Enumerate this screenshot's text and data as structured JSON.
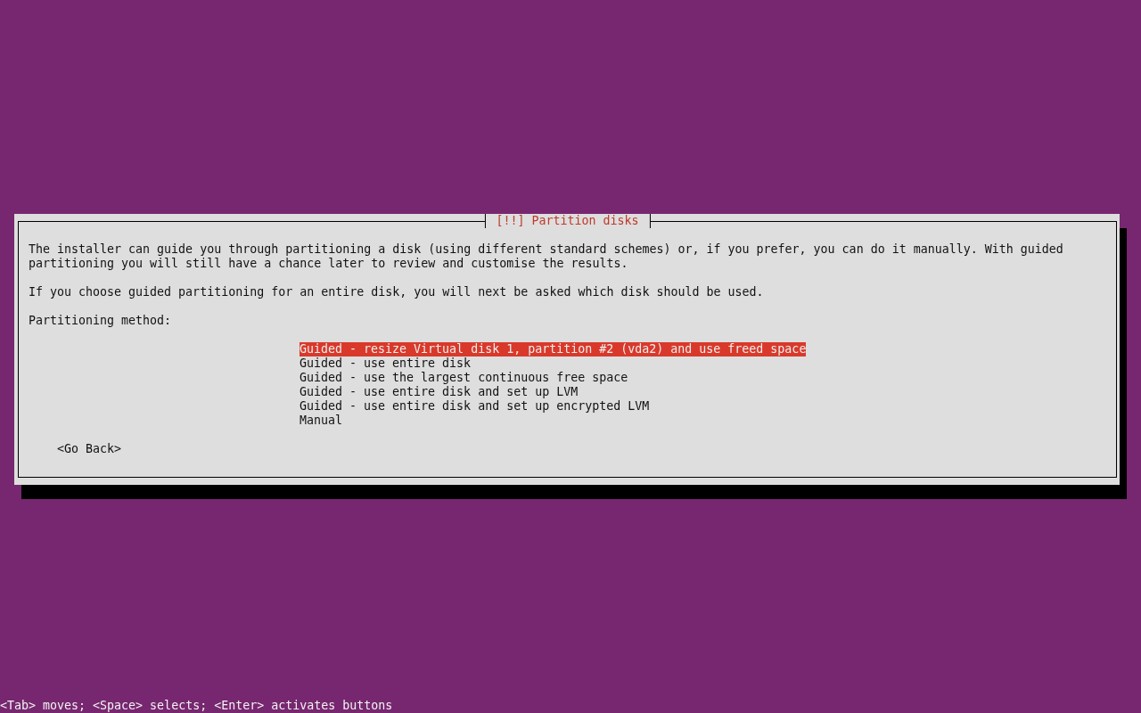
{
  "dialog": {
    "title": "[!!] Partition disks",
    "paragraphs": [
      "The installer can guide you through partitioning a disk (using different standard schemes) or, if you prefer, you can do it manually. With guided partitioning you will still have a chance later to review and customise the results.",
      "If you choose guided partitioning for an entire disk, you will next be asked which disk should be used."
    ],
    "prompt": "Partitioning method:",
    "options": [
      {
        "label": "Guided - resize Virtual disk 1, partition #2 (vda2) and use freed space",
        "selected": true
      },
      {
        "label": "Guided - use entire disk",
        "selected": false
      },
      {
        "label": "Guided - use the largest continuous free space",
        "selected": false
      },
      {
        "label": "Guided - use entire disk and set up LVM",
        "selected": false
      },
      {
        "label": "Guided - use entire disk and set up encrypted LVM",
        "selected": false
      },
      {
        "label": "Manual",
        "selected": false
      }
    ],
    "buttons": [
      "<Go Back>"
    ]
  },
  "status_bar": "<Tab> moves; <Space> selects; <Enter> activates buttons"
}
